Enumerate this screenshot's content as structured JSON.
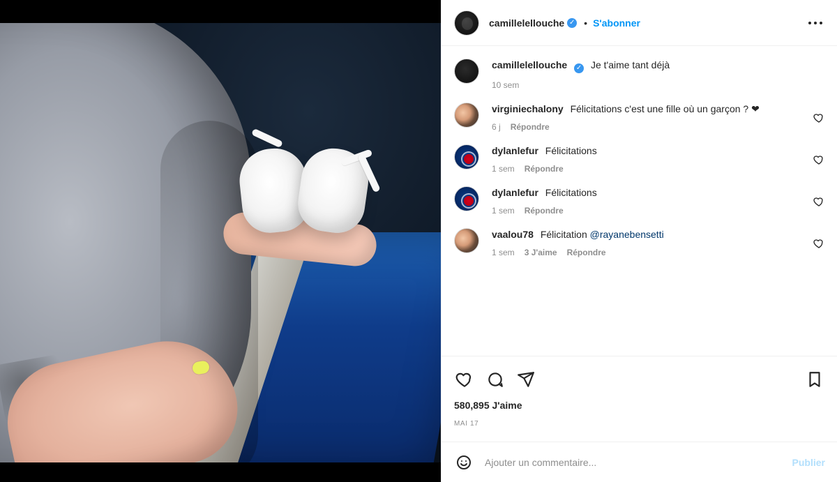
{
  "post": {
    "image_alt": "photo"
  },
  "header": {
    "username": "camillelellouche",
    "verified_mark": "✓",
    "dot": "•",
    "follow_label": "S'abonner",
    "more_icon": "more-horizontal-icon"
  },
  "caption": {
    "username": "camillelellouche",
    "verified_mark": "✓",
    "text": "Je t'aime tant déjà ",
    "time": "10 sem"
  },
  "comments": [
    {
      "username": "virginiechalony",
      "text": "Félicitations c'est une fille où un garçon ? ❤",
      "time": "6 j",
      "reply_label": "Répondre",
      "avatar_style": "people"
    },
    {
      "username": "dylanlefur",
      "text": "Félicitations",
      "time": "1 sem",
      "reply_label": "Répondre",
      "avatar_style": "psg"
    },
    {
      "username": "dylanlefur",
      "text": "Félicitations",
      "time": "1 sem",
      "reply_label": "Répondre",
      "avatar_style": "psg"
    },
    {
      "username": "vaalou78",
      "text_prefix": "Félicitation ",
      "mention": "@rayanebensetti",
      "text_suffix": " ",
      "time": "1 sem",
      "likes_label": "3 J'aime",
      "reply_label": "Répondre",
      "avatar_style": "people"
    }
  ],
  "actions": {
    "like_icon": "heart-icon",
    "comment_icon": "comment-icon",
    "share_icon": "send-icon",
    "save_icon": "bookmark-icon"
  },
  "stats": {
    "likes": "580,895 J'aime",
    "date": "MAI 17"
  },
  "composer": {
    "emoji_icon": "smile-icon",
    "placeholder": "Ajouter un commentaire...",
    "publish_label": "Publier"
  },
  "colors": {
    "accent_blue": "#0095f6",
    "verified_blue": "#3897f0",
    "text_primary": "#262626",
    "text_secondary": "#8e8e8e",
    "divider": "#efefef"
  }
}
